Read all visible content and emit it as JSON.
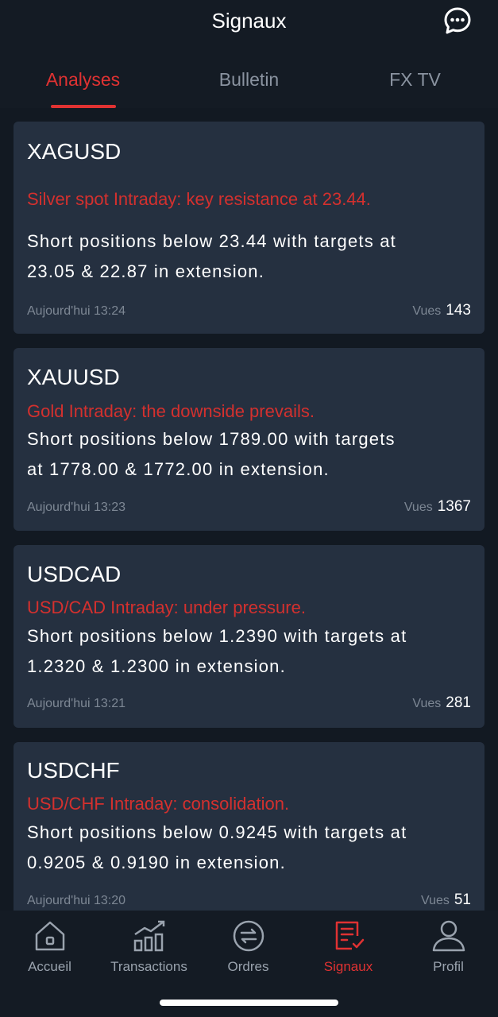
{
  "header": {
    "title": "Signaux",
    "chat_icon": "chat-bubble-icon"
  },
  "tabs": [
    {
      "label": "Analyses",
      "active": true
    },
    {
      "label": "Bulletin",
      "active": false
    },
    {
      "label": "FX TV",
      "active": false
    }
  ],
  "colors": {
    "accent": "#e03232",
    "background": "#121922",
    "card": "#253040",
    "headline": "#d4302e"
  },
  "cards": [
    {
      "symbol": "XAGUSD",
      "headline": "Silver spot Intraday: key resistance at 23.44.",
      "body_lines": [
        "Short positions below 23.44 with targets at",
        "23.05 & 22.87 in extension."
      ],
      "time": "Aujourd'hui 13:24",
      "views_label": "Vues",
      "views": "143"
    },
    {
      "symbol": "XAUUSD",
      "headline": "Gold Intraday: the downside prevails.",
      "body_lines": [
        "Short positions below 1789.00 with targets",
        "at 1778.00 & 1772.00 in extension."
      ],
      "time": "Aujourd'hui 13:23",
      "views_label": "Vues",
      "views": "1367"
    },
    {
      "symbol": "USDCAD",
      "headline": "USD/CAD Intraday: under pressure.",
      "body_lines": [
        "Short positions below 1.2390 with targets at",
        "1.2320 & 1.2300 in extension."
      ],
      "time": "Aujourd'hui 13:21",
      "views_label": "Vues",
      "views": "281"
    },
    {
      "symbol": "USDCHF",
      "headline": "USD/CHF Intraday: consolidation.",
      "body_lines": [
        "Short positions below 0.9245 with targets at",
        "0.9205 & 0.9190 in extension."
      ],
      "time": "Aujourd'hui 13:20",
      "views_label": "Vues",
      "views": "51"
    }
  ],
  "bottom_nav": [
    {
      "label": "Accueil",
      "icon": "home-icon",
      "active": false
    },
    {
      "label": "Transactions",
      "icon": "bar-chart-icon",
      "active": false
    },
    {
      "label": "Ordres",
      "icon": "exchange-icon",
      "active": false
    },
    {
      "label": "Signaux",
      "icon": "signals-icon",
      "active": true
    },
    {
      "label": "Profil",
      "icon": "profile-icon",
      "active": false
    }
  ]
}
